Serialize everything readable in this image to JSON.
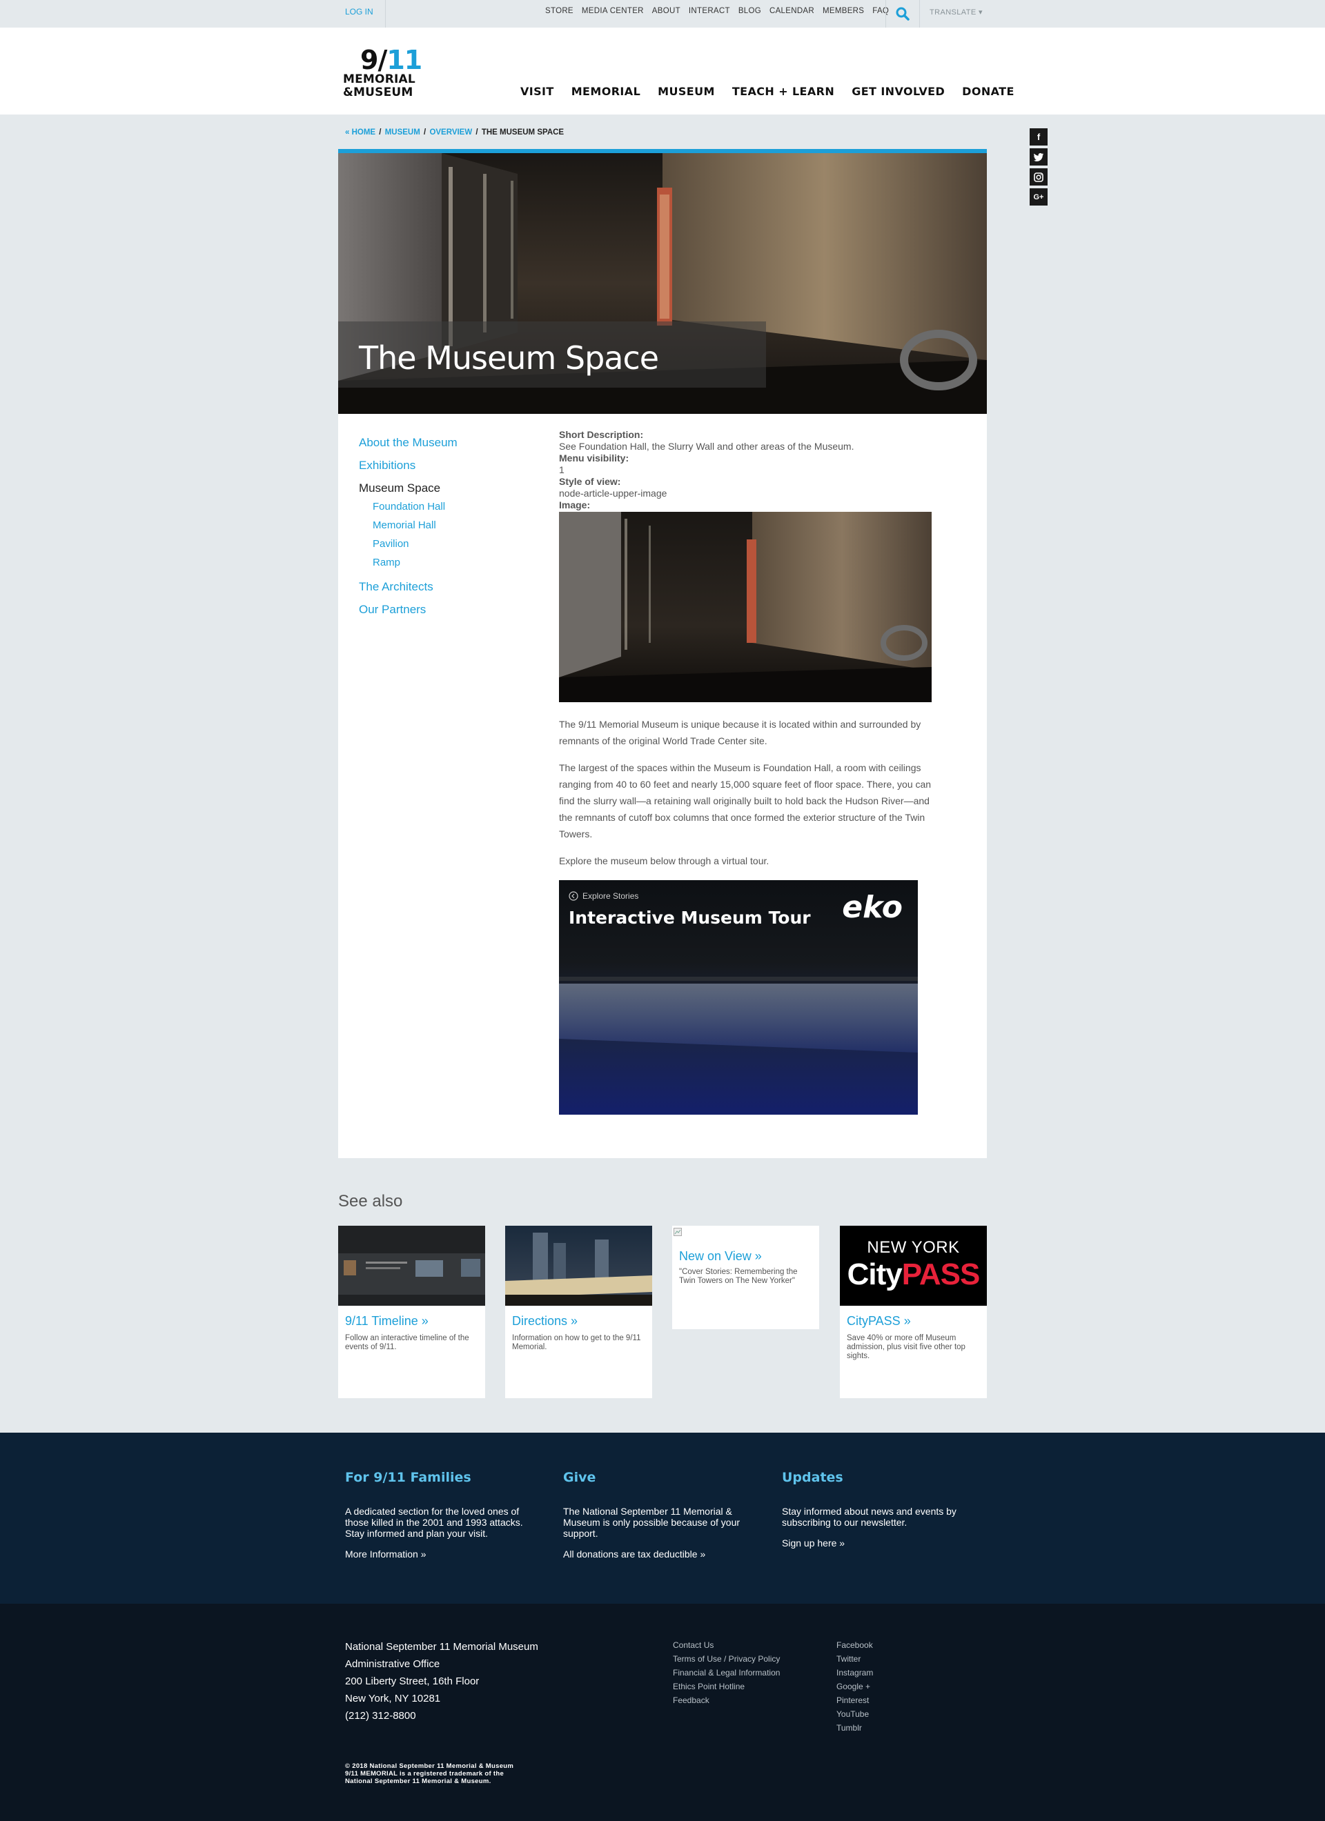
{
  "topbar": {
    "login": "LOG IN",
    "util_links": [
      "STORE",
      "MEDIA CENTER",
      "ABOUT",
      "INTERACT",
      "BLOG",
      "CALENDAR",
      "MEMBERS",
      "FAQ"
    ],
    "translate": "TRANSLATE ▾"
  },
  "logo": {
    "num_a": "9/",
    "num_b": "11",
    "line1": "MEMORIAL",
    "line2": "&MUSEUM"
  },
  "mainnav": [
    "VISIT",
    "MEMORIAL",
    "MUSEUM",
    "TEACH + LEARN",
    "GET INVOLVED",
    "DONATE"
  ],
  "breadcrumb": {
    "home": "« HOME",
    "museum": "MUSEUM",
    "overview": "OVERVIEW",
    "current": "THE MUSEUM SPACE",
    "sep": "/"
  },
  "social": [
    "f",
    "t",
    "◙",
    "G+"
  ],
  "hero": {
    "title": "The Museum Space"
  },
  "sidebar": {
    "about": "About the Museum",
    "exhibitions": "Exhibitions",
    "museum_space": "Museum Space",
    "subs": [
      "Foundation Hall",
      "Memorial Hall",
      "Pavilion",
      "Ramp"
    ],
    "architects": "The Architects",
    "partners": "Our Partners"
  },
  "main": {
    "short_desc_label": "Short Description:",
    "short_desc": "See Foundation Hall, the Slurry Wall and other areas of the Museum.",
    "menu_vis_label": "Menu visibility:",
    "menu_vis": "1",
    "style_label": "Style of view:",
    "style": "node-article-upper-image",
    "image_label": "Image:",
    "p1": "The 9/11 Memorial Museum is unique because it is located within and surrounded by remnants of the original World Trade Center site.",
    "p2": "The largest of the spaces within the Museum is Foundation Hall, a room with ceilings ranging from 40 to 60 feet and nearly 15,000 square feet of floor space. There, you can find the slurry wall—a retaining wall originally built to hold back the Hudson River—and the remnants of cutoff box columns that once formed the exterior structure of the Twin Towers.",
    "p3": "Explore the museum below through a virtual tour.",
    "tour_explore": "Explore Stories",
    "tour_title": "Interactive Museum Tour",
    "tour_brand": "eko"
  },
  "seealso": {
    "title": "See also",
    "cards": [
      {
        "title": "9/11 Timeline »",
        "desc": "Follow an interactive timeline of the events of 9/11."
      },
      {
        "title": "Directions »",
        "desc": "Information on how to get to the 9/11 Memorial."
      },
      {
        "title": "New on View »",
        "desc": "\"Cover Stories: Remembering the Twin Towers on The New Yorker\""
      },
      {
        "title": "CityPASS »",
        "desc": "Save 40% or more off Museum admission, plus visit five other top sights.",
        "logo_top": "NEW YORK",
        "logo_a": "City",
        "logo_b": "PASS"
      }
    ]
  },
  "footer": {
    "families": {
      "title": "For 9/11 Families",
      "desc": "A dedicated section for the loved ones of those killed in the 2001 and 1993 attacks. Stay informed and plan your visit.",
      "link": "More Information »"
    },
    "give": {
      "title": "Give",
      "desc": "The National September 11 Memorial & Museum is only possible because of your support.",
      "link": "All donations are tax deductible »"
    },
    "updates": {
      "title": "Updates",
      "desc": "Stay informed about news and events by subscribing to our newsletter.",
      "link": "Sign up here »"
    },
    "address": [
      "National September 11 Memorial Museum",
      "Administrative Office",
      "200 Liberty Street, 16th Floor",
      "New York, NY 10281",
      "(212) 312-8800"
    ],
    "links1": [
      "Contact Us",
      "Terms of Use / Privacy Policy",
      "Financial & Legal Information",
      "Ethics Point Hotline",
      "Feedback"
    ],
    "links2": [
      "Facebook",
      "Twitter",
      "Instagram",
      "Google +",
      "Pinterest",
      "YouTube",
      "Tumblr"
    ],
    "copyright": [
      "© 2018 National September 11 Memorial & Museum",
      "9/11 MEMORIAL is a registered trademark of the",
      "National September 11 Memorial & Museum."
    ]
  },
  "colors": {
    "accent": "#1c9fd8",
    "footer_blue": "#0c2136",
    "footer_dark": "#0b1521",
    "page_bg": "#e4e9ec"
  }
}
